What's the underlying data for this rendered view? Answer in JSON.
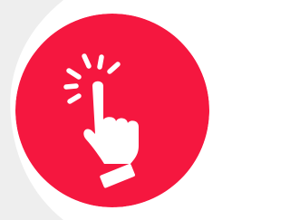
{
  "icon": {
    "name": "tap-hand-icon",
    "background_color": "#F5173F",
    "glyph_color": "#FFFFFF",
    "page_background": "#FFFFFF",
    "side_shade": "#EEEEEE"
  }
}
